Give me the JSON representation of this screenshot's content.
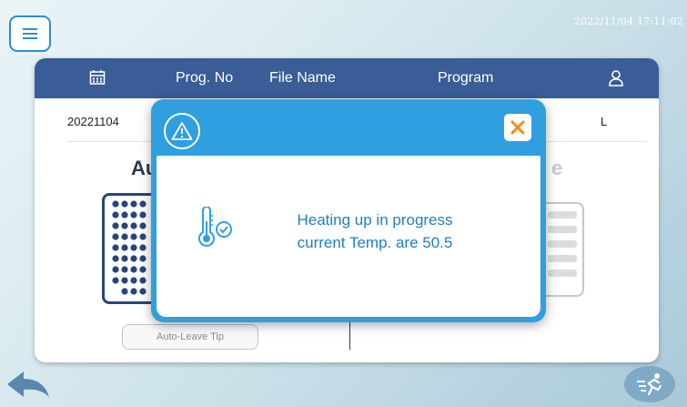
{
  "header": {
    "datetime": "2022/11/04 17:11:02"
  },
  "table": {
    "columns": [
      "Prog. No",
      "File Name",
      "Program"
    ],
    "row": {
      "date": "20221104",
      "user": "L"
    }
  },
  "modes": {
    "left_title_partial": "Au",
    "right_title_partial": "e"
  },
  "buttons": {
    "auto_leave_tip": "Auto-Leave Tip"
  },
  "dialog": {
    "message_line1": "Heating up in progress",
    "message_line2": "current Temp. are 50.5"
  },
  "colors": {
    "header_bar": "#3a5c97",
    "dialog_blue": "#2f9fe0",
    "close_orange": "#f28a1a",
    "message_text": "#1f7fbf"
  },
  "icons": [
    "menu-icon",
    "calendar-icon",
    "user-icon",
    "warning-icon",
    "close-icon",
    "thermometer-check-icon",
    "back-arrow-icon",
    "run-icon"
  ]
}
